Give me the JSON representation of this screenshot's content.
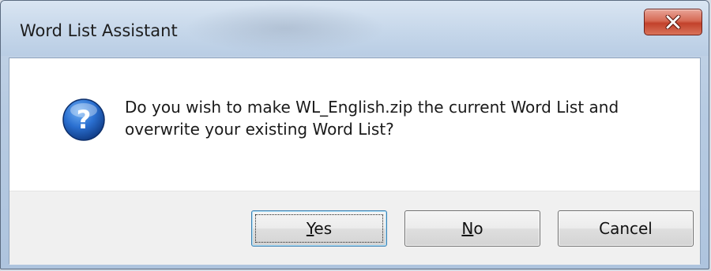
{
  "window": {
    "title": "Word List Assistant",
    "close_glyph": "X"
  },
  "message": {
    "line1": "Do you wish to make WL_English.zip the current Word List and",
    "line2": "overwrite your existing Word List?",
    "icon": "question-icon"
  },
  "buttons": {
    "yes": {
      "mnemonic": "Y",
      "rest": "es"
    },
    "no": {
      "mnemonic": "N",
      "rest": "o"
    },
    "cancel": {
      "label": "Cancel"
    }
  },
  "colors": {
    "close_button": "#c7432d",
    "question_icon": "#1f5fb8",
    "button_face": "#e5e5e5",
    "button_area": "#f0f0f0"
  }
}
